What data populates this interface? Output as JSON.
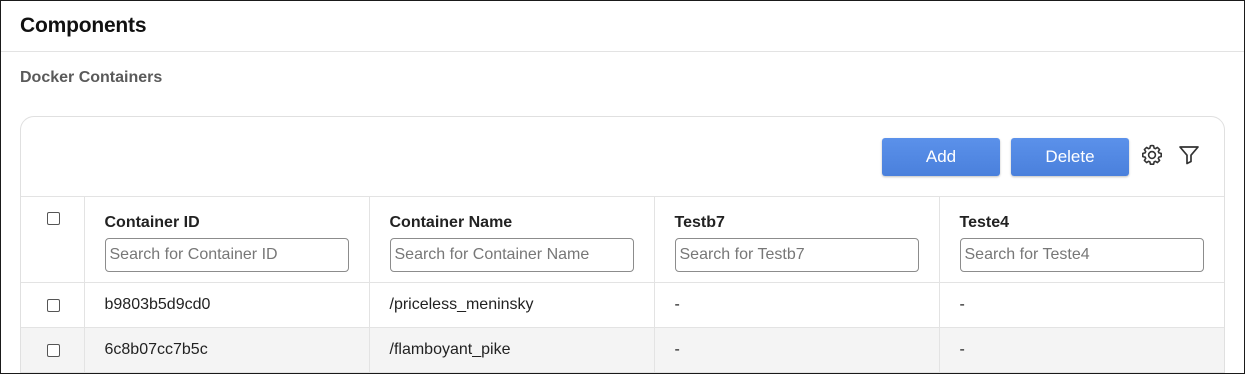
{
  "page": {
    "title": "Components",
    "section_title": "Docker Containers"
  },
  "toolbar": {
    "add_label": "Add",
    "delete_label": "Delete",
    "settings_icon": "gear-icon",
    "filter_icon": "filter-icon",
    "accent_color": "#4f86e0"
  },
  "table": {
    "columns": [
      {
        "label": "Container ID",
        "placeholder": "Search for Container ID"
      },
      {
        "label": "Container Name",
        "placeholder": "Search for Container Name"
      },
      {
        "label": "Testb7",
        "placeholder": "Search for Testb7"
      },
      {
        "label": "Teste4",
        "placeholder": "Search for Teste4"
      }
    ],
    "rows": [
      {
        "id": "b9803b5d9cd0",
        "name": "/priceless_meninsky",
        "testb7": "-",
        "teste4": "-"
      },
      {
        "id": "6c8b07cc7b5c",
        "name": "/flamboyant_pike",
        "testb7": "-",
        "teste4": "-"
      }
    ]
  }
}
